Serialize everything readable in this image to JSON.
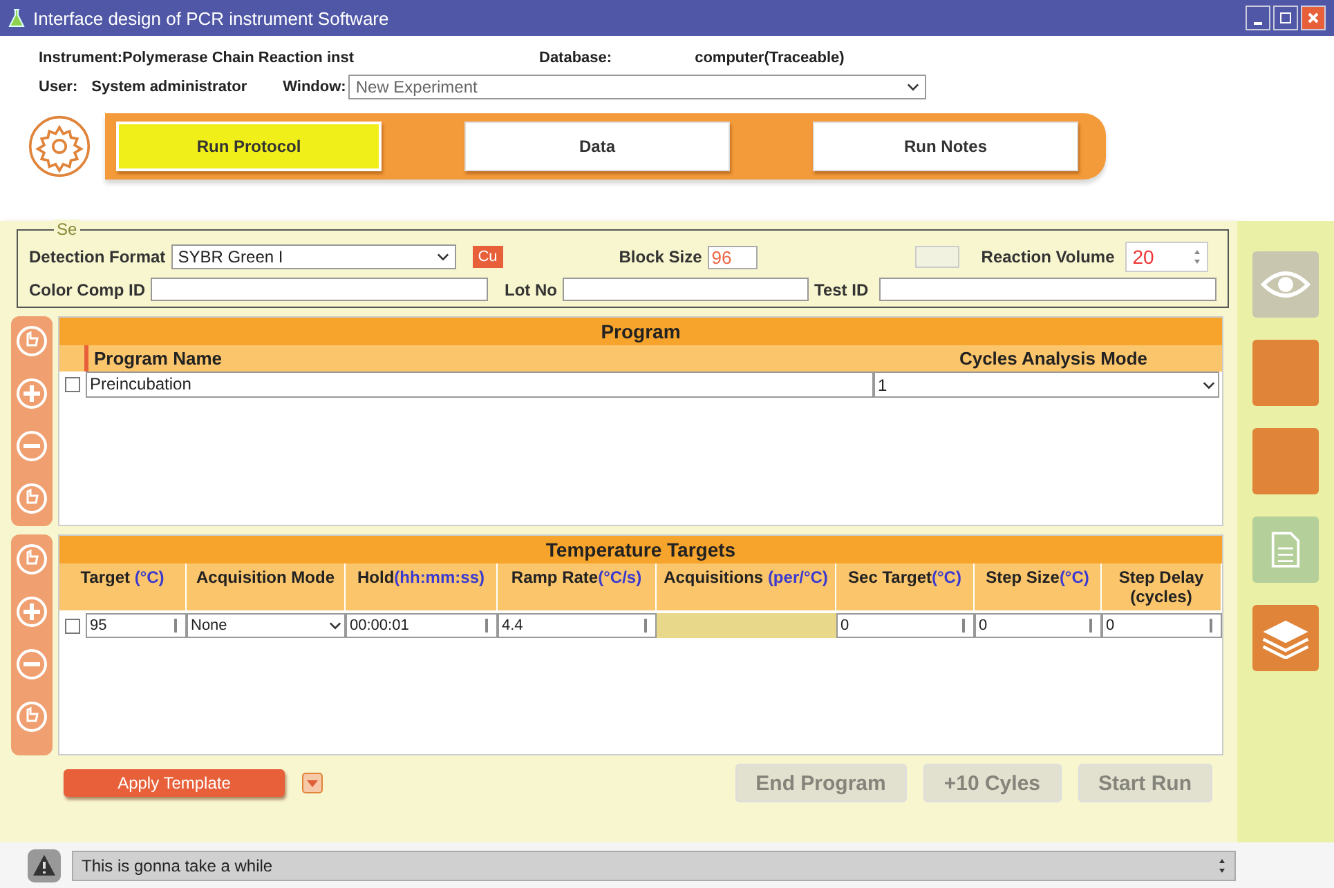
{
  "window": {
    "title": "Interface design of PCR instrument Software"
  },
  "info": {
    "instrument": "Instrument:Polymerase Chain Reaction inst",
    "database_label": "Database:",
    "database_value": "computer(Traceable)",
    "user_label": "User:",
    "user_value": "System administrator",
    "window_label": "Window:",
    "window_value": "New Experiment"
  },
  "nav_tabs": [
    {
      "label": "Run Protocol",
      "selected": true
    },
    {
      "label": "Data",
      "selected": false
    },
    {
      "label": "Run Notes",
      "selected": false
    }
  ],
  "settings": {
    "legend": "Se",
    "detection_label": "Detection Format",
    "detection_value": "SYBR Green I",
    "custom_button": "Cu",
    "block_size_label": "Block Size",
    "block_size_value": "96",
    "reaction_volume_label": "Reaction Volume",
    "reaction_volume_value": "20",
    "color_comp_label": "Color Comp ID",
    "lot_label": "Lot No",
    "test_label": "Test ID"
  },
  "program": {
    "title": "Program",
    "columns": [
      "Program Name",
      "Cycles Analysis Mode"
    ],
    "rows": [
      {
        "checked": false,
        "name": "Preincubation",
        "value": "1"
      }
    ]
  },
  "targets": {
    "title": "Temperature Targets",
    "columns": [
      {
        "label": "Target ",
        "unit": "(°C)"
      },
      {
        "label": "Acquisition Mode"
      },
      {
        "label": "Hold",
        "unit": "(hh:mm:ss)"
      },
      {
        "label": "Ramp Rate",
        "unit": "(°C/s)"
      },
      {
        "label": "Acquisitions ",
        "unit": "(per/°C)"
      },
      {
        "label": "Sec Target",
        "unit": "(°C)"
      },
      {
        "label": "Step Size",
        "unit": "(°C)"
      },
      {
        "label": "Step Delay (cycles)"
      }
    ],
    "rows": [
      {
        "checked": false,
        "target": "95",
        "mode": "None",
        "hold": "00:00:01",
        "ramp": "4.4",
        "sec_target": "0",
        "step_size": "0",
        "step_delay": "0"
      }
    ]
  },
  "apply_template": "Apply Template",
  "run_buttons": [
    {
      "label": "End Program",
      "disabled": true
    },
    {
      "label": "+10 Cyles",
      "disabled": true
    },
    {
      "label": "Start Run",
      "disabled": true
    }
  ],
  "side_buttons": [
    {
      "kind": "eye"
    },
    {
      "kind": "blank"
    },
    {
      "kind": "blank"
    },
    {
      "kind": "document"
    },
    {
      "kind": "layers"
    }
  ],
  "status": {
    "message": "This is gonna take a while"
  }
}
